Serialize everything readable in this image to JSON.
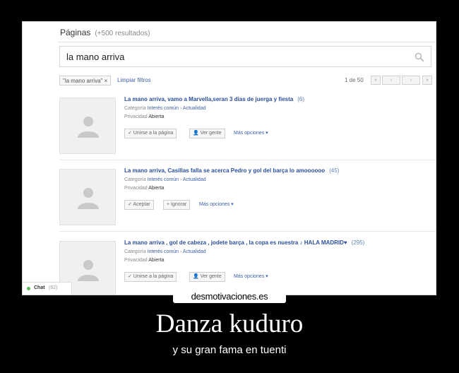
{
  "page": {
    "heading": "Páginas",
    "result_count": "(+500 resultados)"
  },
  "search": {
    "query": "la mano arriva"
  },
  "filter": {
    "chip_label": "\"la mano arriva\"",
    "chip_close": "×",
    "clear_label": "Limpiar filtros"
  },
  "pager": {
    "range_text": "1 de 50",
    "first": "«",
    "prev": "‹",
    "next": "›",
    "last": "»"
  },
  "results": [
    {
      "title": "La mano arriva, vamo a Marvella,seran 3 dias de juerga y fiesta",
      "members": "(6)",
      "category_label": "Categoría",
      "category_value": "Interés común",
      "category_sep": "›",
      "subcategory": "Actualidad",
      "privacy_label": "Privacidad",
      "privacy_value": "Abierta",
      "action_label": "✓ Unirse a la página",
      "people_label": "👤 Ver gente",
      "more_label": "Más opciones ▾"
    },
    {
      "title": "La mano arriva, Casillas falla se acerca Pedro y gol del barça lo amoooooo",
      "members": "(45)",
      "category_label": "Categoría",
      "category_value": "Interés común",
      "category_sep": "›",
      "subcategory": "Actualidad",
      "privacy_label": "Privacidad",
      "privacy_value": "Abierta",
      "action_label": "✓ Aceptar",
      "people_label": "+ Ignorar",
      "more_label": "Más opciones ▾"
    },
    {
      "title": "La mano arriva , gol de cabeza , jodete barça , la copa es nuestra ♪ HALA MADRID♥",
      "members": "(295)",
      "category_label": "Categoría",
      "category_value": "Interés común",
      "category_sep": "›",
      "subcategory": "Actualidad",
      "privacy_label": "Privacidad",
      "privacy_value": "Abierta",
      "action_label": "✓ Unirse a la página",
      "people_label": "👤 Ver gente",
      "more_label": "Más opciones ▾"
    }
  ],
  "chat": {
    "label": "Chat",
    "count": "(62)"
  },
  "poster": {
    "logo": "desmotivaciones.es",
    "title": "Danza kuduro",
    "subtitle": "y su gran fama en tuenti"
  },
  "colors": {
    "link": "#2b4f9b",
    "background": "#000000",
    "online": "#5cb85c"
  }
}
